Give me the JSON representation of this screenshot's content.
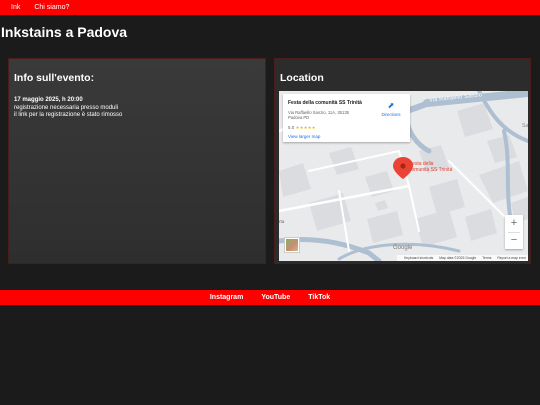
{
  "nav": {
    "items": [
      "Ink",
      "Chi siamo?"
    ]
  },
  "page": {
    "title": "Inkstains a Padova"
  },
  "info": {
    "heading": "Info sull'evento:",
    "date_line": "17 maggio 2025, h 20:00",
    "line1": "registrazione necessaria presso moduli",
    "line2": "il link per la registrazione è stato rimosso"
  },
  "location": {
    "heading": "Location",
    "map": {
      "place_name": "Festa della comunità SS Trinità",
      "address_line1": "Via Raffaello Sanzio, 11A, 35135",
      "address_line2": "Padova PD",
      "rating": "5.0",
      "stars": "★★★★★",
      "larger_map": "View larger map",
      "directions": "Directions",
      "pin_label_1": "Festa della",
      "pin_label_2": "comunità SS Trinità",
      "street": "Via Raffaello Sanzio",
      "street_fragment_right": "Sa",
      "street_fragment_left": "rta",
      "zoom_in": "+",
      "zoom_out": "−",
      "google": "Google",
      "footer_shortcuts": "Keyboard shortcuts",
      "footer_mapdata": "Map data ©2025 Google",
      "footer_terms": "Terms",
      "footer_report": "Report a map error"
    }
  },
  "footer": {
    "links": [
      "Instagram",
      "YouTube",
      "TikTok"
    ]
  },
  "colors": {
    "accent": "#ff0000",
    "background": "#1b1b1b",
    "card": "#2e2e2e",
    "pin": "#e04130",
    "link": "#1a73e8"
  }
}
